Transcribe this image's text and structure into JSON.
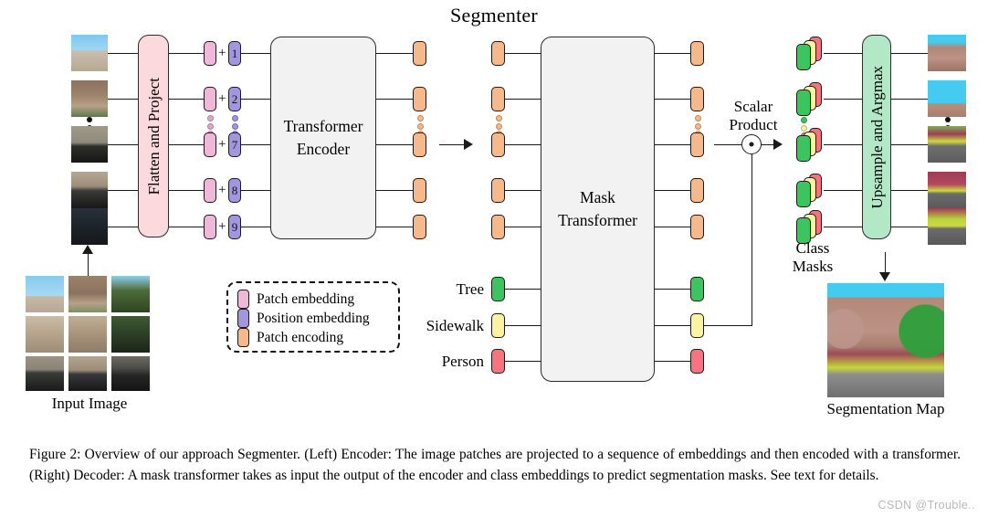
{
  "title": "Segmenter",
  "encoder": {
    "flatten_box_label": "Flatten and Project",
    "transformer_box_label": "Transformer\nEncoder",
    "input_image_label": "Input Image",
    "position_numbers": [
      "1",
      "2",
      "7",
      "8",
      "9"
    ],
    "plus_sign": "+"
  },
  "decoder": {
    "mask_transformer_label": "Mask\nTransformer",
    "upsample_box_label": "Upsample and Argmax",
    "scalar_product_label": "Scalar\nProduct",
    "class_masks_label": "Class\nMasks",
    "segmentation_map_label": "Segmentation Map",
    "class_labels": [
      "Tree",
      "Sidewalk",
      "Person"
    ]
  },
  "legend": {
    "items": [
      {
        "label": "Patch embedding",
        "color": "#f0b8d8"
      },
      {
        "label": "Position embedding",
        "color": "#a396e0"
      },
      {
        "label": "Patch encoding",
        "color": "#f8b98a"
      }
    ]
  },
  "colors": {
    "patch_embedding": "#f0b8d8",
    "position_embedding": "#a396e0",
    "patch_encoding": "#f8b98a",
    "tree": "#3cc45f",
    "sidewalk": "#fbf3a0",
    "person": "#f8737f",
    "flatten_box": "#fbd9dd",
    "upsample_box": "#b3e8c6",
    "transformer_box": "#f2f2f2"
  },
  "caption": "Figure 2: Overview of our approach Segmenter. (Left) Encoder: The image patches are projected to a sequence of embeddings and then encoded with a transformer. (Right) Decoder: A mask transformer takes as input the output of the encoder and class embeddings to predict segmentation masks. See text for details.",
  "watermark": "CSDN @Trouble.."
}
